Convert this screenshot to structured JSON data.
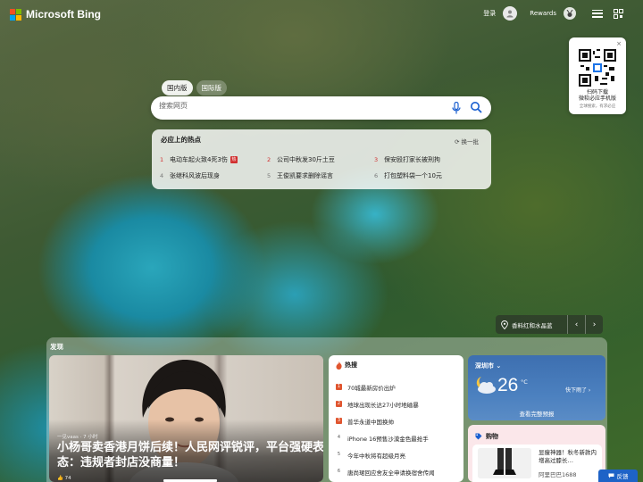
{
  "header": {
    "brand": "Microsoft Bing",
    "signin_label": "登录",
    "rewards_label": "Rewards",
    "logo_colors": [
      "#f25022",
      "#7fba00",
      "#00a4ef",
      "#ffb900"
    ]
  },
  "qr_panel": {
    "close": "×",
    "line1": "扫码下载",
    "line2": "微软必应手机版",
    "line3": "全球搜索，有求必应"
  },
  "search": {
    "tabs": [
      {
        "label": "国内版",
        "active": true
      },
      {
        "label": "国际版",
        "active": false
      }
    ],
    "placeholder": "搜索网页"
  },
  "hot": {
    "title": "必应上的热点",
    "refresh": "换一批",
    "items": [
      {
        "rank": "1",
        "text": "电动车起火致4死3伤",
        "badge": "热"
      },
      {
        "rank": "2",
        "text": "公司中秋发30斤土豆"
      },
      {
        "rank": "3",
        "text": "保安殴打家长被刑拘"
      },
      {
        "rank": "4",
        "text": "张继科风波后现身"
      },
      {
        "rank": "5",
        "text": "王俊凯要求删除谣言"
      },
      {
        "rank": "6",
        "text": "打包塑料袋一个10元"
      }
    ]
  },
  "location": {
    "text": "香料红和水晶蓝",
    "prev": "‹",
    "next": "›"
  },
  "feed": {
    "title": "发现",
    "hero": {
      "source": "一见vaas · 7 小时",
      "headline": "小杨哥卖香港月饼后续！人民网评锐评，平台强硬表态：违规者封店没商量！",
      "likes": "74"
    },
    "trending": {
      "title": "热搜",
      "items": [
        {
          "rank": "1",
          "text": "70城最新房价出炉"
        },
        {
          "rank": "2",
          "text": "地球出现长达27小时地磁暴"
        },
        {
          "rank": "3",
          "text": "普华永道中国换帅"
        },
        {
          "rank": "4",
          "text": "iPhone 16预售沙漠金色最抢手"
        },
        {
          "rank": "5",
          "text": "今年中秋将有超级月亮"
        },
        {
          "rank": "6",
          "text": "唐尚珺回应舍友全申请换宿舍传闻"
        }
      ]
    },
    "weather": {
      "city": "深圳市",
      "temp": "26",
      "unit": "°C",
      "condition": "快下雨了",
      "more": "查看完整预报"
    },
    "shopping": {
      "title": "购物",
      "product": "显瘦神器！秋冬新款内增高过膝长…",
      "seller": "阿里巴巴1688"
    }
  },
  "feedback_label": "反馈"
}
